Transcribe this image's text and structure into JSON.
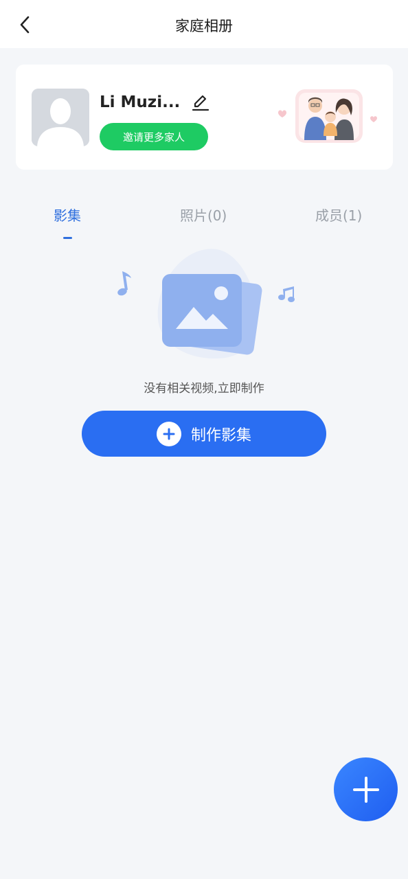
{
  "header": {
    "title": "家庭相册",
    "back_icon": "chevron-left-icon"
  },
  "profile": {
    "name": "Li Muzi...",
    "edit_icon": "pencil-icon",
    "invite_label": "邀请更多家人",
    "invite_color": "#1ecb63"
  },
  "tabs": [
    {
      "label": "影集",
      "active": true
    },
    {
      "label": "照片(0)",
      "active": false
    },
    {
      "label": "成员(1)",
      "active": false
    }
  ],
  "empty_state": {
    "message": "没有相关视频,立即制作",
    "button_label": "制作影集",
    "icon": "image-stack-icon"
  },
  "fab": {
    "icon": "plus-icon"
  },
  "colors": {
    "accent": "#2a6ef2",
    "active_tab": "#2f6fde",
    "background": "#f4f6f9"
  }
}
